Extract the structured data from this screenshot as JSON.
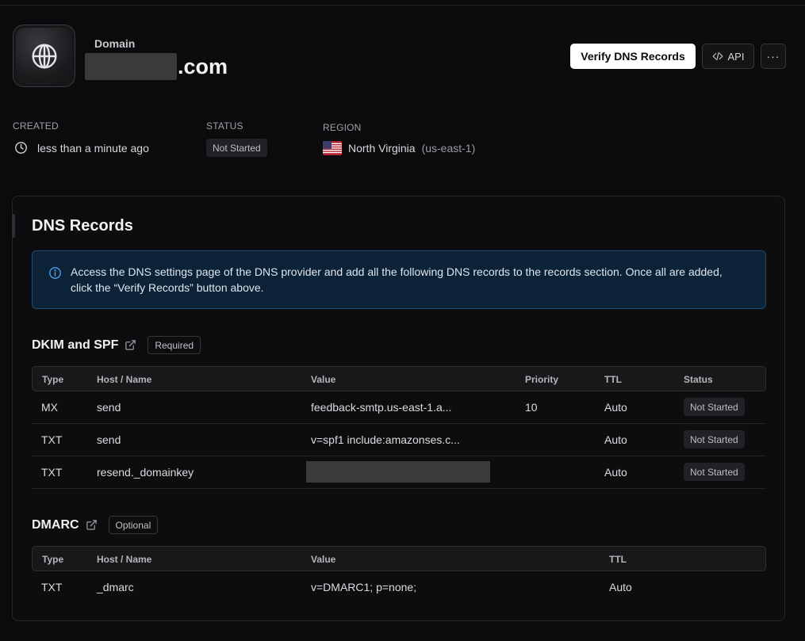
{
  "header": {
    "domain_label": "Domain",
    "domain_tld": ".com",
    "verify_button": "Verify DNS Records",
    "api_button": "API",
    "more_button": "···"
  },
  "meta": {
    "created_label": "CREATED",
    "created_value": "less than a minute ago",
    "status_label": "STATUS",
    "status_value": "Not Started",
    "region_label": "REGION",
    "region_name": "North Virginia",
    "region_code": "(us-east-1)"
  },
  "dns": {
    "title": "DNS Records",
    "info_text": "Access the DNS settings page of the DNS provider and add all the following DNS records to the records section. Once all are added, click the “Verify Records” button above.",
    "dkim": {
      "title": "DKIM and SPF",
      "badge": "Required",
      "columns": [
        "Type",
        "Host / Name",
        "Value",
        "Priority",
        "TTL",
        "Status"
      ],
      "rows": [
        {
          "type": "MX",
          "host": "send",
          "value": "feedback-smtp.us-east-1.a...",
          "priority": "10",
          "ttl": "Auto",
          "status": "Not Started"
        },
        {
          "type": "TXT",
          "host": "send",
          "value": "v=spf1 include:amazonses.c...",
          "priority": "",
          "ttl": "Auto",
          "status": "Not Started"
        },
        {
          "type": "TXT",
          "host": "resend._domainkey",
          "value": "",
          "priority": "",
          "ttl": "Auto",
          "status": "Not Started"
        }
      ]
    },
    "dmarc": {
      "title": "DMARC",
      "badge": "Optional",
      "columns": [
        "Type",
        "Host / Name",
        "Value",
        "TTL"
      ],
      "rows": [
        {
          "type": "TXT",
          "host": "_dmarc",
          "value": "v=DMARC1; p=none;",
          "ttl": "Auto"
        }
      ]
    }
  },
  "colors": {
    "background": "#0b0b0d",
    "info_bg": "#0c2236",
    "info_border": "#1d4a72",
    "info_icon": "#4a9ee8",
    "pill_bg": "#222226"
  },
  "icons": {
    "domain_logo": "globe-icon",
    "created": "clock-icon",
    "region": "us-flag-icon",
    "info": "info-icon",
    "api": "code-icon",
    "external_link": "external-link-icon"
  }
}
